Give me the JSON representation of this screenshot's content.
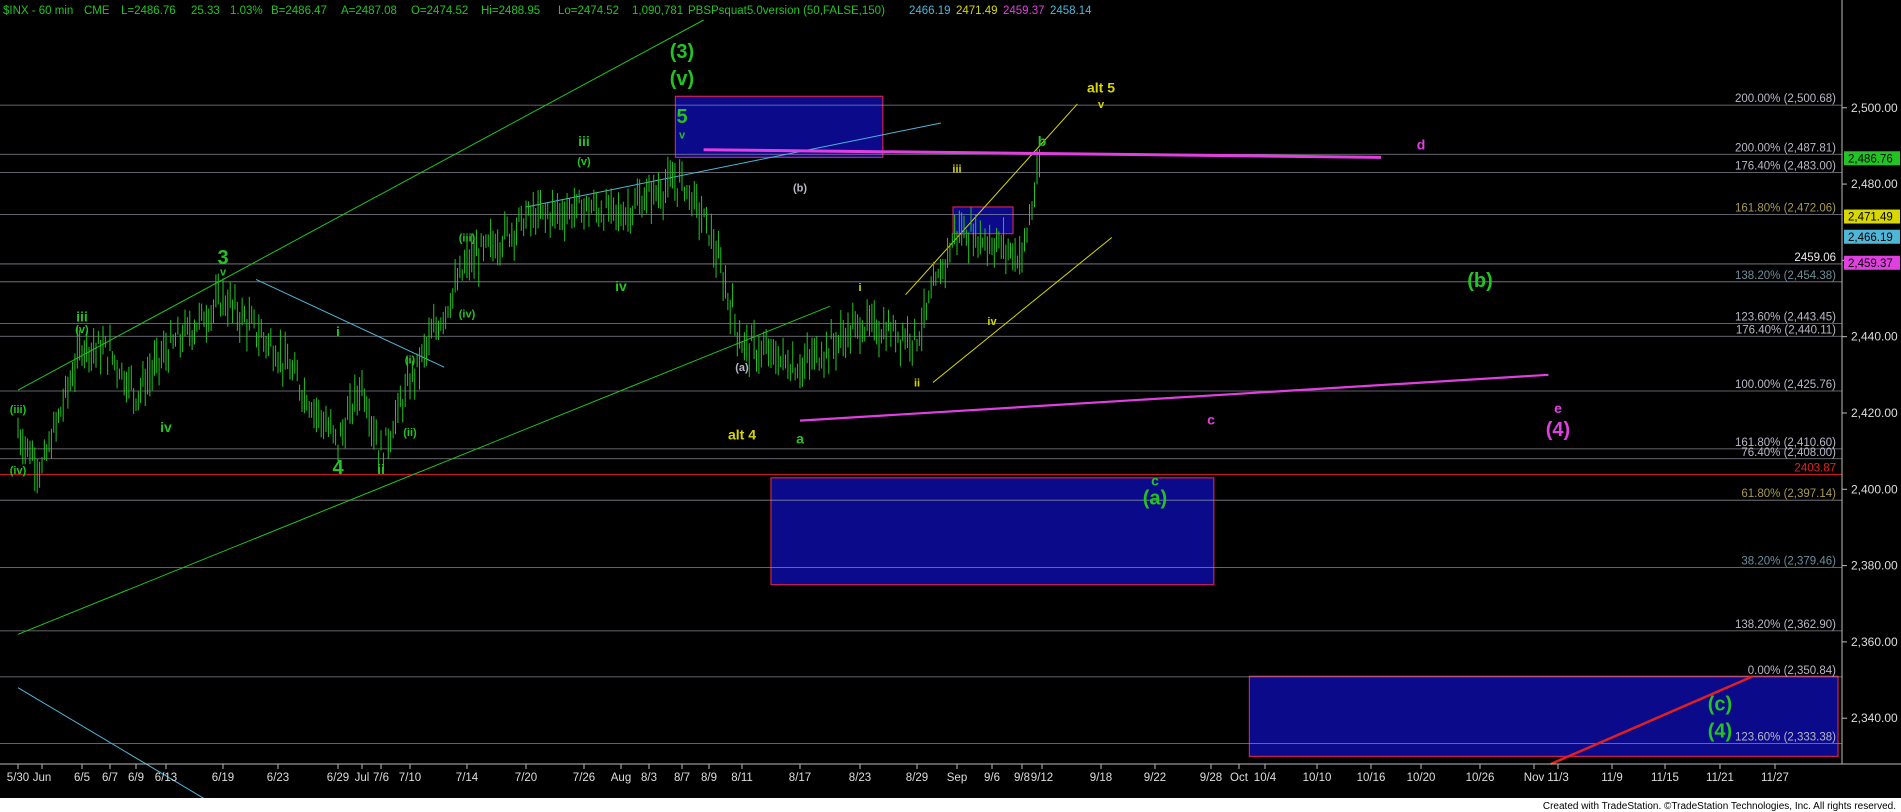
{
  "header": {
    "symbol": "$INX - 60 min",
    "exchange": "CME",
    "last": "L=2486.76",
    "change": "25.33",
    "change_pct": "1.03%",
    "bid": "B=2486.47",
    "ask": "A=2487.08",
    "open": "O=2474.52",
    "high": "Hi=2488.95",
    "low": "Lo=2474.52",
    "volume": "1,090,781",
    "indicator": "PBSPsquat5.0version (50,FALSE,150)",
    "ind_values": [
      {
        "text": "2466.19",
        "color": "#4fb6d8"
      },
      {
        "text": "2471.49",
        "color": "#d8d800"
      },
      {
        "text": "2459.37",
        "color": "#e040e0"
      },
      {
        "text": "2458.14",
        "color": "#4fb6d8"
      }
    ]
  },
  "footer": "Created with TradeStation. ©TradeStation Technologies, Inc. All rights reserved.",
  "colors": {
    "background": "#000000",
    "price_bars": "#22c322",
    "green": "#22c322",
    "magenta": "#e040e0",
    "yellow": "#d8d800",
    "cyan": "#4fb6d8",
    "red": "#e02020",
    "box_fill": "#0a0a8a",
    "box_border": "#d02050"
  },
  "chart_data": {
    "type": "line",
    "y_axis_label_values": [
      2340,
      2360,
      2380,
      2400,
      2420,
      2440,
      2460,
      2480,
      2500
    ],
    "ylim": [
      2328,
      2523
    ],
    "x_ticks": [
      "5/30",
      "Jun",
      "6/5",
      "6/7",
      "6/9",
      "6/13",
      "6/19",
      "6/23",
      "6/29",
      "Jul",
      "7/6",
      "7/10",
      "7/14",
      "7/20",
      "7/26",
      "Aug",
      "8/3",
      "8/7",
      "8/9",
      "8/11",
      "8/17",
      "8/23",
      "8/29",
      "Sep",
      "9/6",
      "9/8",
      "9/12",
      "9/18",
      "9/22",
      "9/28",
      "Oct",
      "10/4",
      "10/10",
      "10/16",
      "10/20",
      "10/26",
      "Nov",
      "11/3",
      "11/9",
      "11/15",
      "11/21",
      "11/27"
    ],
    "price_path": [
      {
        "x": "5/30",
        "y": 2415
      },
      {
        "x": "Jun",
        "y": 2405
      },
      {
        "x": "6/5",
        "y": 2438
      },
      {
        "x": "6/7",
        "y": 2436
      },
      {
        "x": "6/9",
        "y": 2425
      },
      {
        "x": "6/13",
        "y": 2436
      },
      {
        "x": "6/19",
        "y": 2450
      },
      {
        "x": "6/23",
        "y": 2436
      },
      {
        "x": "6/29",
        "y": 2412
      },
      {
        "x": "Jul",
        "y": 2428
      },
      {
        "x": "7/6",
        "y": 2409
      },
      {
        "x": "7/10",
        "y": 2428
      },
      {
        "x": "7/14",
        "y": 2459
      },
      {
        "x": "7/20",
        "y": 2471
      },
      {
        "x": "7/26",
        "y": 2474
      },
      {
        "x": "Aug",
        "y": 2472
      },
      {
        "x": "8/3",
        "y": 2477
      },
      {
        "x": "8/7",
        "y": 2481
      },
      {
        "x": "8/9",
        "y": 2468
      },
      {
        "x": "8/11",
        "y": 2438
      },
      {
        "x": "8/17",
        "y": 2432
      },
      {
        "x": "8/23",
        "y": 2443
      },
      {
        "x": "8/29",
        "y": 2440
      },
      {
        "x": "Sep",
        "y": 2468
      },
      {
        "x": "9/6",
        "y": 2465
      },
      {
        "x": "9/8",
        "y": 2461
      },
      {
        "x": "9/12",
        "y": 2487
      }
    ],
    "fib_levels": [
      {
        "label": "200.00% (2,500.68)",
        "value": 2500.68,
        "color": "#b8b8c8"
      },
      {
        "label": "200.00% (2,487.81)",
        "value": 2487.81,
        "color": "#b8b8c8"
      },
      {
        "label": "176.40% (2,483.00)",
        "value": 2483.0,
        "color": "#b8b8c8"
      },
      {
        "label": "161.80% (2,472.06)",
        "value": 2472.06,
        "color": "#a89a50"
      },
      {
        "label": "2459.06",
        "value": 2459.06,
        "color": "#e8e8e8"
      },
      {
        "label": "138.20% (2,454.38)",
        "value": 2454.38,
        "color": "#6a8f9c"
      },
      {
        "label": "123.60% (2,443.45)",
        "value": 2443.45,
        "color": "#b8b8c8"
      },
      {
        "label": "176.40% (2,440.11)",
        "value": 2440.11,
        "color": "#b8b8c8"
      },
      {
        "label": "100.00% (2,425.76)",
        "value": 2425.76,
        "color": "#b8b8c8"
      },
      {
        "label": "161.80% (2,410.60)",
        "value": 2410.6,
        "color": "#b8b8c8"
      },
      {
        "label": "76.40% (2,408.00)",
        "value": 2408.0,
        "color": "#b8b8c8"
      },
      {
        "label": "2403.87",
        "value": 2403.87,
        "color": "#e02020"
      },
      {
        "label": "61.80% (2,397.14)",
        "value": 2397.14,
        "color": "#a89a50"
      },
      {
        "label": "38.20% (2,379.46)",
        "value": 2379.46,
        "color": "#6a8f9c"
      },
      {
        "label": "138.20% (2,362.90)",
        "value": 2362.9,
        "color": "#b8b8c8"
      },
      {
        "label": "0.00% (2,350.84)",
        "value": 2350.84,
        "color": "#b8b8c8"
      },
      {
        "label": "123.60% (2,333.38)",
        "value": 2333.38,
        "color": "#b8b8c8"
      }
    ],
    "price_tags": [
      {
        "text": "2,486.76",
        "value": 2486.76,
        "bg": "#22c322",
        "fg": "#000000"
      },
      {
        "text": "2,471.49",
        "value": 2471.49,
        "bg": "#d8d800",
        "fg": "#000000"
      },
      {
        "text": "2,466.19",
        "value": 2466.19,
        "bg": "#4fb6d8",
        "fg": "#000000"
      },
      {
        "text": "2,459.37",
        "value": 2459.37,
        "bg": "#e040e0",
        "fg": "#000000"
      }
    ],
    "wave_labels": [
      {
        "text": "(3)",
        "x": "8/7",
        "y": 2513,
        "color": "#22c322",
        "size": "large"
      },
      {
        "text": "(v)",
        "x": "8/7",
        "y": 2506,
        "color": "#22c322",
        "size": "large"
      },
      {
        "text": "5",
        "x": "8/7",
        "y": 2496,
        "color": "#22c322",
        "size": "large"
      },
      {
        "text": "v",
        "x": "8/7",
        "y": 2492,
        "color": "#22c322",
        "size": "small"
      },
      {
        "text": "alt 5",
        "x": "9/18",
        "y": 2504,
        "color": "#d8d800",
        "size": "medium"
      },
      {
        "text": "v",
        "x": "9/18",
        "y": 2500,
        "color": "#d8d800",
        "size": "small"
      },
      {
        "text": "b",
        "x": "9/12",
        "y": 2490,
        "color": "#22c322",
        "size": "medium"
      },
      {
        "text": "d",
        "x": "10/20",
        "y": 2489,
        "color": "#e040e0",
        "size": "medium"
      },
      {
        "text": "iii",
        "x": "7/26",
        "y": 2490,
        "color": "#22c322",
        "size": "medium"
      },
      {
        "text": "(v)",
        "x": "7/26",
        "y": 2485,
        "color": "#22c322",
        "size": "small"
      },
      {
        "text": "(b)",
        "x": "8/17",
        "y": 2478,
        "color": "#b8b8c8",
        "size": "small"
      },
      {
        "text": "iii",
        "x": "Sep",
        "y": 2483,
        "color": "#d8d800",
        "size": "small"
      },
      {
        "text": "3",
        "x": "6/19",
        "y": 2459,
        "color": "#22c322",
        "size": "large"
      },
      {
        "text": "v",
        "x": "6/19",
        "y": 2456,
        "color": "#22c322",
        "size": "small"
      },
      {
        "text": "iii",
        "x": "6/5",
        "y": 2444,
        "color": "#22c322",
        "size": "medium"
      },
      {
        "text": "(v)",
        "x": "6/5",
        "y": 2441,
        "color": "#22c322",
        "size": "small"
      },
      {
        "text": "(iii)",
        "x": "7/14",
        "y": 2465,
        "color": "#22c322",
        "size": "small"
      },
      {
        "text": "(iv)",
        "x": "7/14",
        "y": 2445,
        "color": "#22c322",
        "size": "small"
      },
      {
        "text": "iv",
        "x": "Aug",
        "y": 2452,
        "color": "#22c322",
        "size": "medium"
      },
      {
        "text": "i",
        "x": "8/23",
        "y": 2452,
        "color": "#d8d800",
        "size": "small"
      },
      {
        "text": "iv",
        "x": "9/6",
        "y": 2443,
        "color": "#d8d800",
        "size": "small"
      },
      {
        "text": "(b)",
        "x": "10/26",
        "y": 2453,
        "color": "#22c322",
        "size": "large"
      },
      {
        "text": "i",
        "x": "6/29",
        "y": 2440,
        "color": "#22c322",
        "size": "medium"
      },
      {
        "text": "(i)",
        "x": "7/10",
        "y": 2433,
        "color": "#22c322",
        "size": "small"
      },
      {
        "text": "(ii)",
        "x": "7/10",
        "y": 2414,
        "color": "#22c322",
        "size": "small"
      },
      {
        "text": "(iii)",
        "x": "5/30",
        "y": 2420,
        "color": "#22c322",
        "size": "small"
      },
      {
        "text": "(iv)",
        "x": "5/30",
        "y": 2404,
        "color": "#22c322",
        "size": "small"
      },
      {
        "text": "iv",
        "x": "6/13",
        "y": 2415,
        "color": "#22c322",
        "size": "medium"
      },
      {
        "text": "(a)",
        "x": "8/11",
        "y": 2431,
        "color": "#b8b8c8",
        "size": "small"
      },
      {
        "text": "ii",
        "x": "8/29",
        "y": 2427,
        "color": "#d8d800",
        "size": "small"
      },
      {
        "text": "alt 4",
        "x": "8/11",
        "y": 2413,
        "color": "#d8d800",
        "size": "medium"
      },
      {
        "text": "a",
        "x": "8/17",
        "y": 2412,
        "color": "#22c322",
        "size": "medium"
      },
      {
        "text": "c",
        "x": "9/28",
        "y": 2417,
        "color": "#e040e0",
        "size": "medium"
      },
      {
        "text": "e",
        "x": "11/3",
        "y": 2420,
        "color": "#e040e0",
        "size": "medium"
      },
      {
        "text": "(4)",
        "x": "11/3",
        "y": 2414,
        "color": "#e040e0",
        "size": "large"
      },
      {
        "text": "4",
        "x": "6/29",
        "y": 2404,
        "color": "#22c322",
        "size": "large"
      },
      {
        "text": "ii",
        "x": "7/6",
        "y": 2404,
        "color": "#22c322",
        "size": "medium"
      },
      {
        "text": "c",
        "x": "9/22",
        "y": 2401,
        "color": "#22c322",
        "size": "medium"
      },
      {
        "text": "(a)",
        "x": "9/22",
        "y": 2396,
        "color": "#22c322",
        "size": "large"
      },
      {
        "text": "(c)",
        "x": "11/21",
        "y": 2342,
        "color": "#22c322",
        "size": "large"
      },
      {
        "text": "(4)",
        "x": "11/21",
        "y": 2335,
        "color": "#22c322",
        "size": "large"
      }
    ]
  }
}
